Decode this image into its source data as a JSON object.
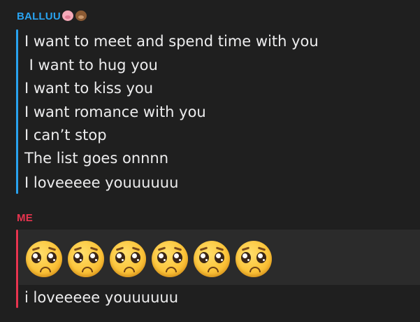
{
  "messages": [
    {
      "sender": "BALLUU",
      "sender_icons": [
        "pig-icon",
        "bear-icon"
      ],
      "sender_color": "#29a3f0",
      "lines": [
        "I want to meet and spend time with you",
        " I want to hug you",
        "I want to kiss you",
        "I want romance with you",
        "I can’t stop",
        "The list goes onnnn",
        "I loveeeee youuuuuu"
      ]
    },
    {
      "sender": "ME",
      "sender_color": "#e8344f",
      "emoji_row": {
        "icon": "pleading-face-icon",
        "count": 6
      },
      "lines": [
        "i loveeeee youuuuuu"
      ]
    }
  ],
  "colors": {
    "background": "#1f1f1f",
    "text": "#ededee",
    "quote_blue": "#29a3f0",
    "quote_red": "#e8344f",
    "emoji_bg": "#2b2b2b"
  }
}
